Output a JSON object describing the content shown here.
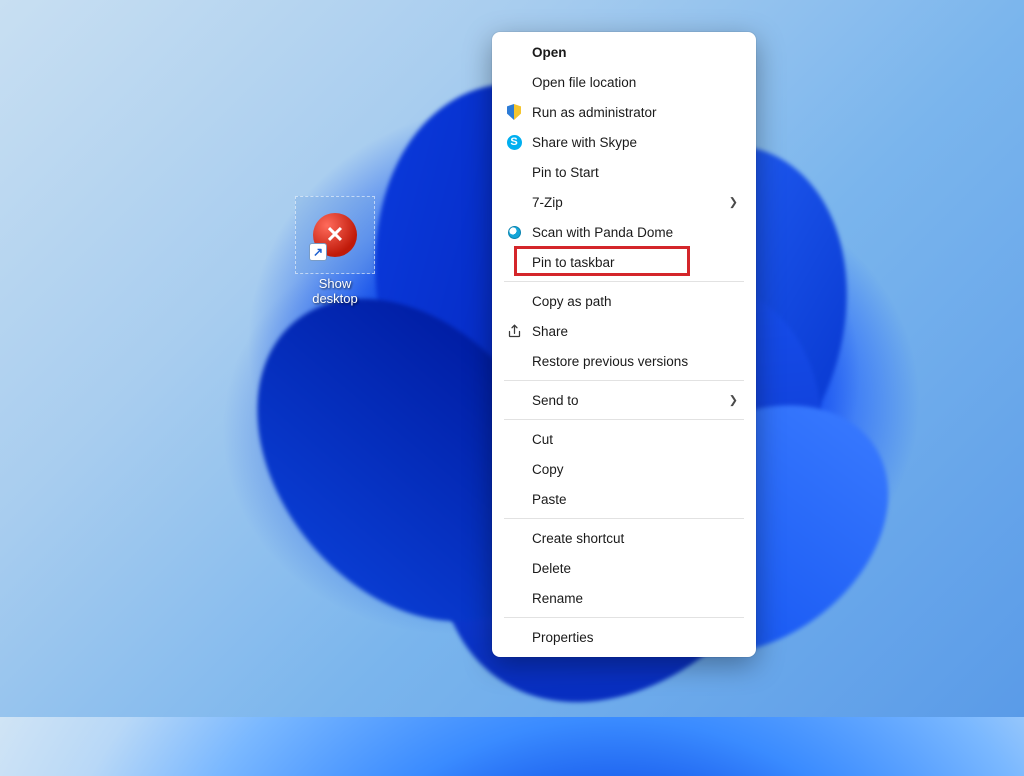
{
  "desktop": {
    "icon_label_line1": "Show",
    "icon_label_line2": "desktop"
  },
  "context_menu": {
    "open": "Open",
    "open_location": "Open file location",
    "run_admin": "Run as administrator",
    "share_skype": "Share with Skype",
    "pin_start": "Pin to Start",
    "seven_zip": "7-Zip",
    "scan_panda": "Scan with Panda Dome",
    "pin_taskbar": "Pin to taskbar",
    "copy_path": "Copy as path",
    "share": "Share",
    "restore_prev": "Restore previous versions",
    "send_to": "Send to",
    "cut": "Cut",
    "copy": "Copy",
    "paste": "Paste",
    "create_shortcut": "Create shortcut",
    "delete": "Delete",
    "rename": "Rename",
    "properties": "Properties"
  },
  "highlight": {
    "target": "pin_taskbar"
  }
}
